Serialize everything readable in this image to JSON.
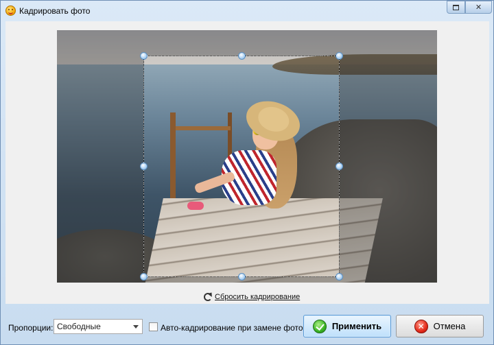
{
  "window": {
    "title": "Кадрировать фото",
    "close_glyph": "✕"
  },
  "crop": {
    "reset_label": "Сбросить кадрирование"
  },
  "footer": {
    "proportions_label": "Пропорции:",
    "proportions_value": "Свободные",
    "autocrop_label": "Авто-кадрирование при замене фото",
    "autocrop_checked": false,
    "apply_label": "Применить",
    "cancel_label": "Отмена",
    "cancel_glyph": "✕"
  },
  "colors": {
    "apply_border": "#5a9ad6",
    "handle": "#a9cff2"
  }
}
